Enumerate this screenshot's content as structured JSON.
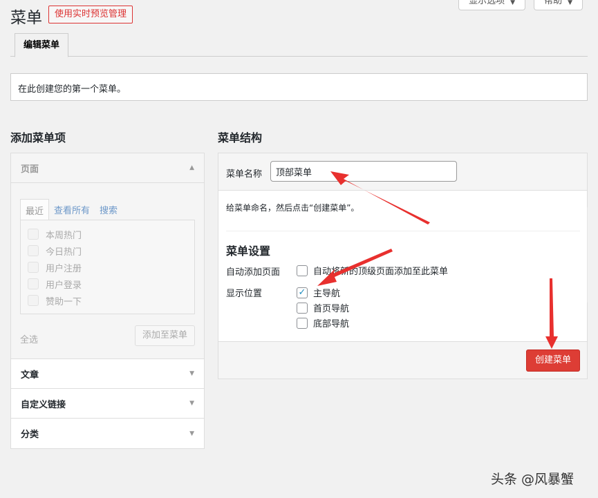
{
  "header": {
    "title": "菜单",
    "live_preview_label": "使用实时预览管理",
    "screen_options_label": "显示选项",
    "help_label": "帮助"
  },
  "tabs": [
    {
      "label": "编辑菜单"
    }
  ],
  "notice": "在此创建您的第一个菜单。",
  "add_items": {
    "heading": "添加菜单项",
    "sections": [
      {
        "label": "页面"
      },
      {
        "label": "文章"
      },
      {
        "label": "自定义链接"
      },
      {
        "label": "分类"
      }
    ],
    "inner_tabs": [
      "最近",
      "查看所有",
      "搜索"
    ],
    "pages": [
      "本周热门",
      "今日热门",
      "用户注册",
      "用户登录",
      "赞助一下"
    ],
    "select_all": "全选",
    "add_button": "添加至菜单"
  },
  "structure": {
    "heading": "菜单结构",
    "name_label": "菜单名称",
    "name_value": "顶部菜单",
    "hint": "给菜单命名，然后点击“创建菜单”。",
    "settings_title": "菜单设置",
    "auto_add_label": "自动添加页面",
    "auto_add_option": "自动将新的顶级页面添加至此菜单",
    "location_label": "显示位置",
    "locations": [
      {
        "label": "主导航",
        "checked": true
      },
      {
        "label": "首页导航",
        "checked": false
      },
      {
        "label": "底部导航",
        "checked": false
      }
    ],
    "create_button": "创建菜单"
  },
  "watermark": "头条 @风暴蟹",
  "colors": {
    "accent_red": "#dd3d35",
    "arrow_red": "#e8302e"
  }
}
